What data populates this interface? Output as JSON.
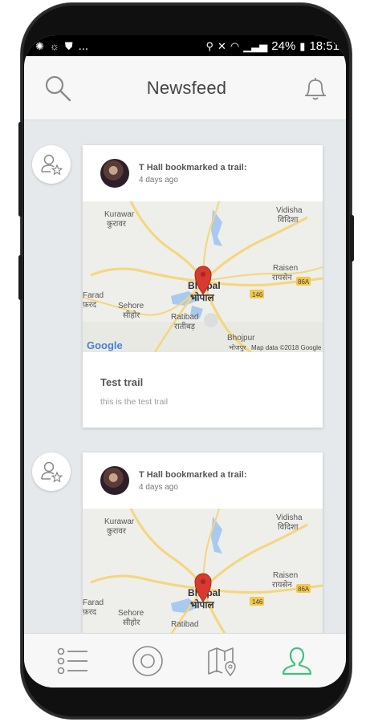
{
  "statusbar": {
    "left_icons": [
      "settings-icon",
      "sync-icon",
      "shield-icon"
    ],
    "more": "...",
    "right_icons": [
      "location-icon",
      "mute-icon",
      "wifi-icon",
      "signal-icon"
    ],
    "battery": "24%",
    "time": "18:51"
  },
  "header": {
    "title": "Newsfeed",
    "left_icon": "search-icon",
    "right_icon": "bell-icon"
  },
  "feed": [
    {
      "activity_icon": "user-star-icon",
      "actor": "T Hall bookmarked a trail:",
      "time": "4 days ago",
      "map_labels": {
        "kurawar": "Kurawar",
        "kurawar_hi": "कुरावर",
        "vidisha": "Vidisha",
        "vidisha_hi": "विदिशा",
        "raisen": "Raisen",
        "raisen_hi": "रायसेन",
        "farad": "Farad",
        "farad_hi": "फ़रद",
        "sehore": "Sehore",
        "sehore_hi": "सीहोर",
        "bhopal": "Bhopal",
        "bhopal_hi": "भोपाल",
        "ratibad": "Ratibad",
        "ratibad_hi": "रातीबड़",
        "bhojpur": "Bhojpur",
        "bhojpur_hi": "भोजपुर",
        "road_146": "146",
        "road_86a": "86A",
        "google": "Google",
        "map_data": "Map data ©2018 Google"
      },
      "trail_name": "Test trail",
      "trail_desc": "this is the test trail"
    },
    {
      "activity_icon": "user-star-icon",
      "actor": "T Hall bookmarked a trail:",
      "time": "4 days ago",
      "map_labels": {
        "kurawar": "Kurawar",
        "kurawar_hi": "कुरावर",
        "vidisha": "Vidisha",
        "vidisha_hi": "विदिशा",
        "raisen": "Raisen",
        "raisen_hi": "रायसेन",
        "farad": "Farad",
        "farad_hi": "फ़रद",
        "sehore": "Sehore",
        "sehore_hi": "सीहोर",
        "bhopal": "Bhopal",
        "bhopal_hi": "भोपाल",
        "ratibad": "Ratibad",
        "road_146": "146",
        "road_86a": "86A"
      }
    }
  ],
  "bottom_nav": [
    {
      "icon": "list-icon"
    },
    {
      "icon": "target-icon"
    },
    {
      "icon": "map-pin-icon"
    },
    {
      "icon": "profile-icon",
      "active": true
    }
  ],
  "colors": {
    "accent": "#3cc47c",
    "pin": "#d93a2f",
    "map_bg": "#eeeeea",
    "road": "#f5d67c",
    "water": "#a9c9ef"
  }
}
